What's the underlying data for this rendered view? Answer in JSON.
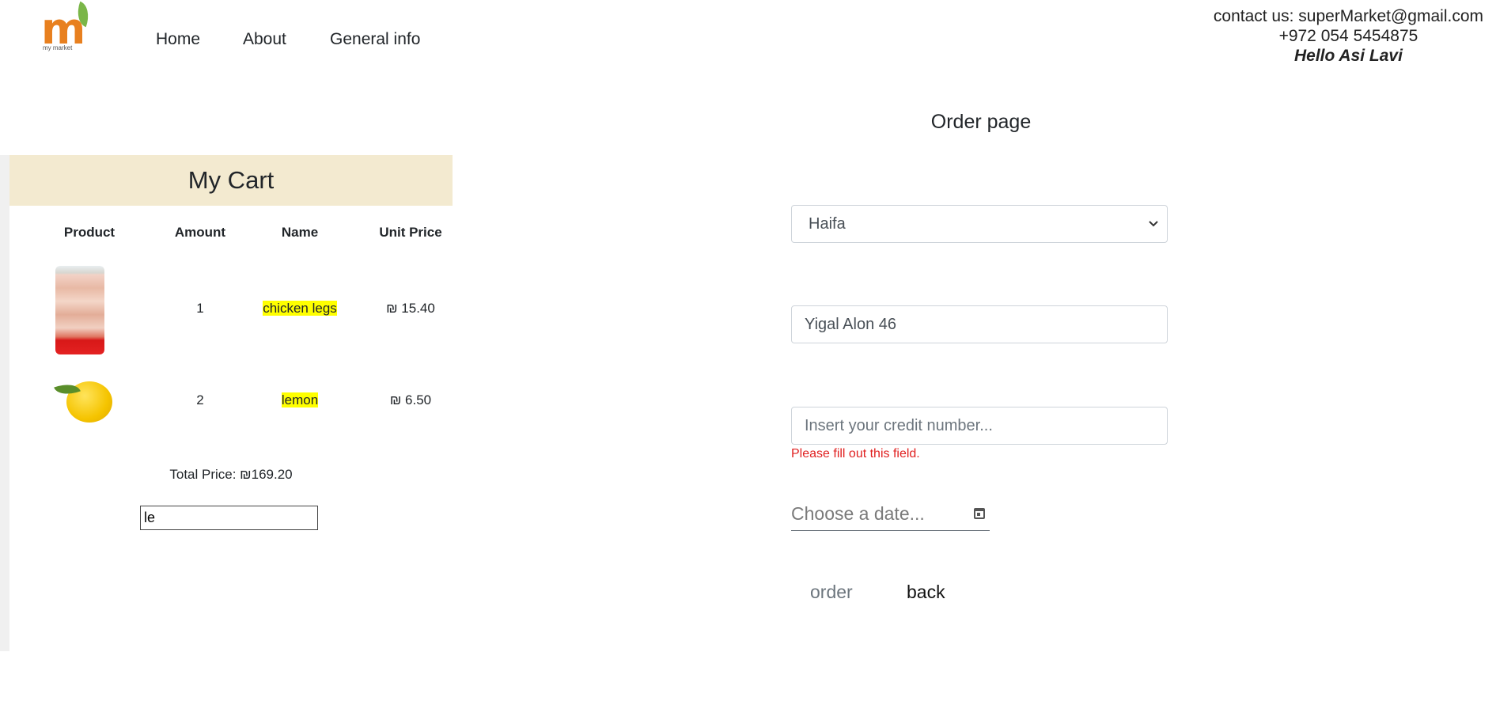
{
  "header": {
    "logo_text": "my market",
    "nav": [
      {
        "label": "Home"
      },
      {
        "label": "About"
      },
      {
        "label": "General info"
      }
    ],
    "contact_line": "contact us: superMarket@gmail.com",
    "phone": "+972 054 5454875",
    "greeting": "Hello Asi Lavi"
  },
  "cart": {
    "title": "My Cart",
    "columns": [
      "Product",
      "Amount",
      "Name",
      "Unit Price"
    ],
    "items": [
      {
        "image": "chicken-legs-image",
        "amount": "1",
        "name": "chicken legs",
        "unit_price": "₪ 15.40"
      },
      {
        "image": "lemon-image",
        "amount": "2",
        "name": "lemon",
        "unit_price": "₪ 6.50"
      }
    ],
    "total": "Total Price: ₪169.20",
    "search_value": "le",
    "highlight_color": "#ffff00",
    "header_bg": "#f3ead0"
  },
  "order": {
    "title": "Order page",
    "city_selected": "Haifa",
    "address_value": "Yigal Alon 46",
    "credit_placeholder": "Insert your credit number...",
    "error_text": "Please fill out this field.",
    "date_placeholder": "Choose a date...",
    "order_label": "order",
    "back_label": "back",
    "error_color": "#e02020"
  }
}
